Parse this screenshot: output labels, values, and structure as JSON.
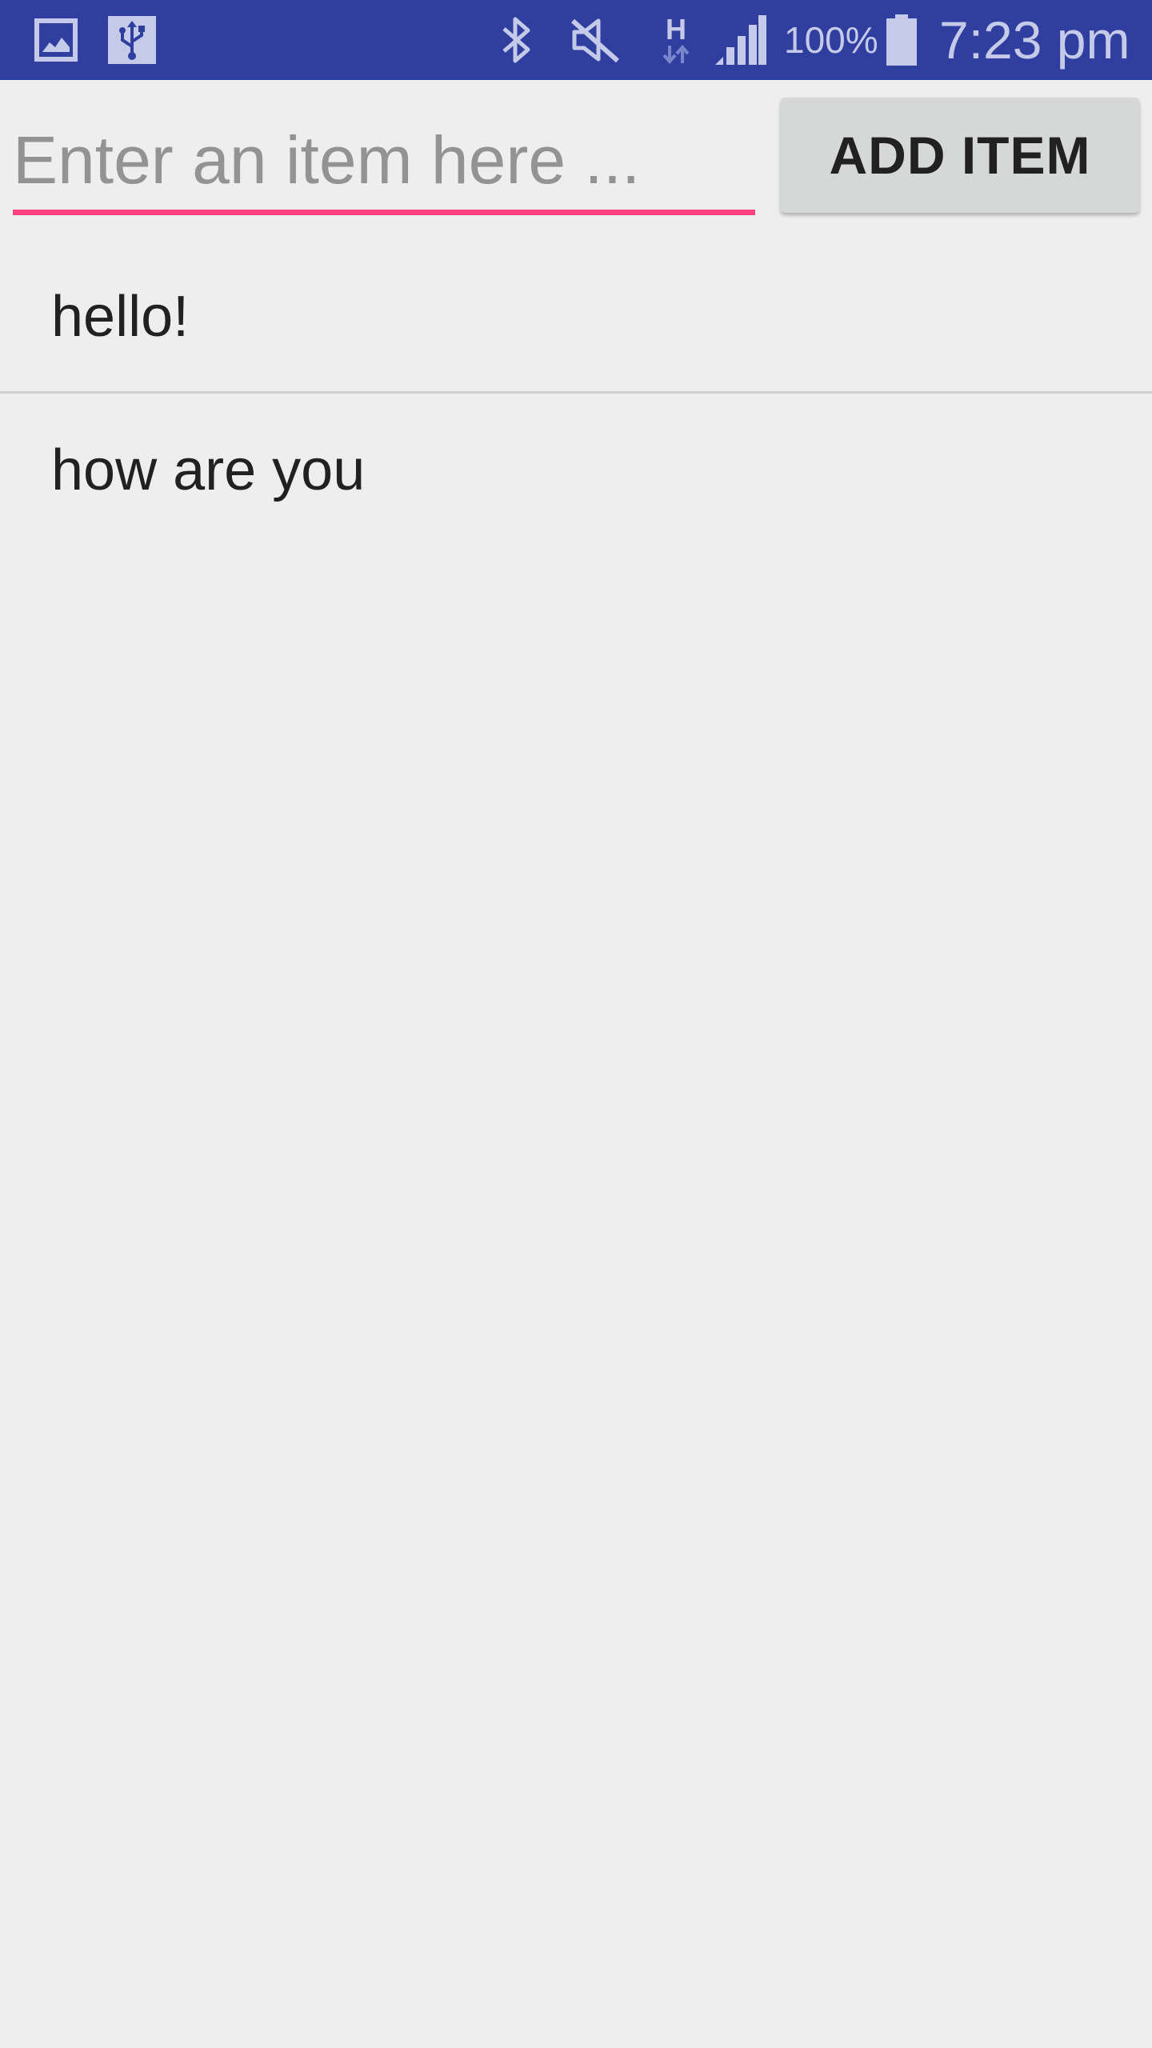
{
  "status_bar": {
    "notification_icons": [
      "gallery-icon",
      "usb-icon"
    ],
    "system_icons": [
      "bluetooth-icon",
      "mute-icon",
      "hspa-data-icon",
      "signal-icon",
      "battery-icon"
    ],
    "data_network_label": "H",
    "battery_percent": "100%",
    "time": "7:23 pm",
    "background_color": "#303f9f",
    "icon_color": "#c5cae9"
  },
  "input_row": {
    "item_input": {
      "value": "",
      "placeholder": "Enter an item here ..."
    },
    "add_button_label": "ADD ITEM",
    "accent_color": "#ff4081"
  },
  "item_list": {
    "items": [
      {
        "label": "hello!"
      },
      {
        "label": "how are you"
      }
    ]
  }
}
